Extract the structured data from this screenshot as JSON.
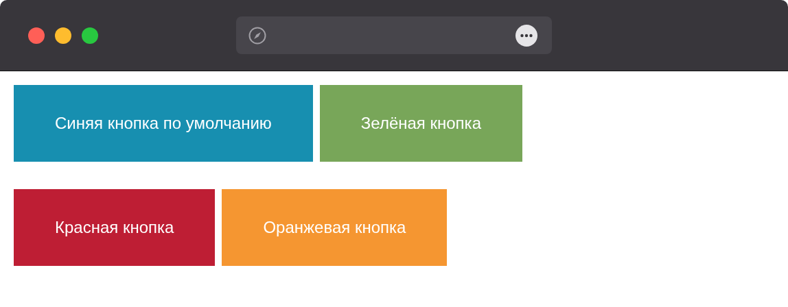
{
  "rows": [
    {
      "buttons": [
        {
          "label": "Синяя кнопка по умолчанию",
          "color": "#178fb0"
        },
        {
          "label": "Зелёная кнопка",
          "color": "#78a659"
        }
      ]
    },
    {
      "buttons": [
        {
          "label": "Красная кнопка",
          "color": "#be1e34"
        },
        {
          "label": "Оранжевая кнопка",
          "color": "#f59631"
        }
      ]
    }
  ]
}
